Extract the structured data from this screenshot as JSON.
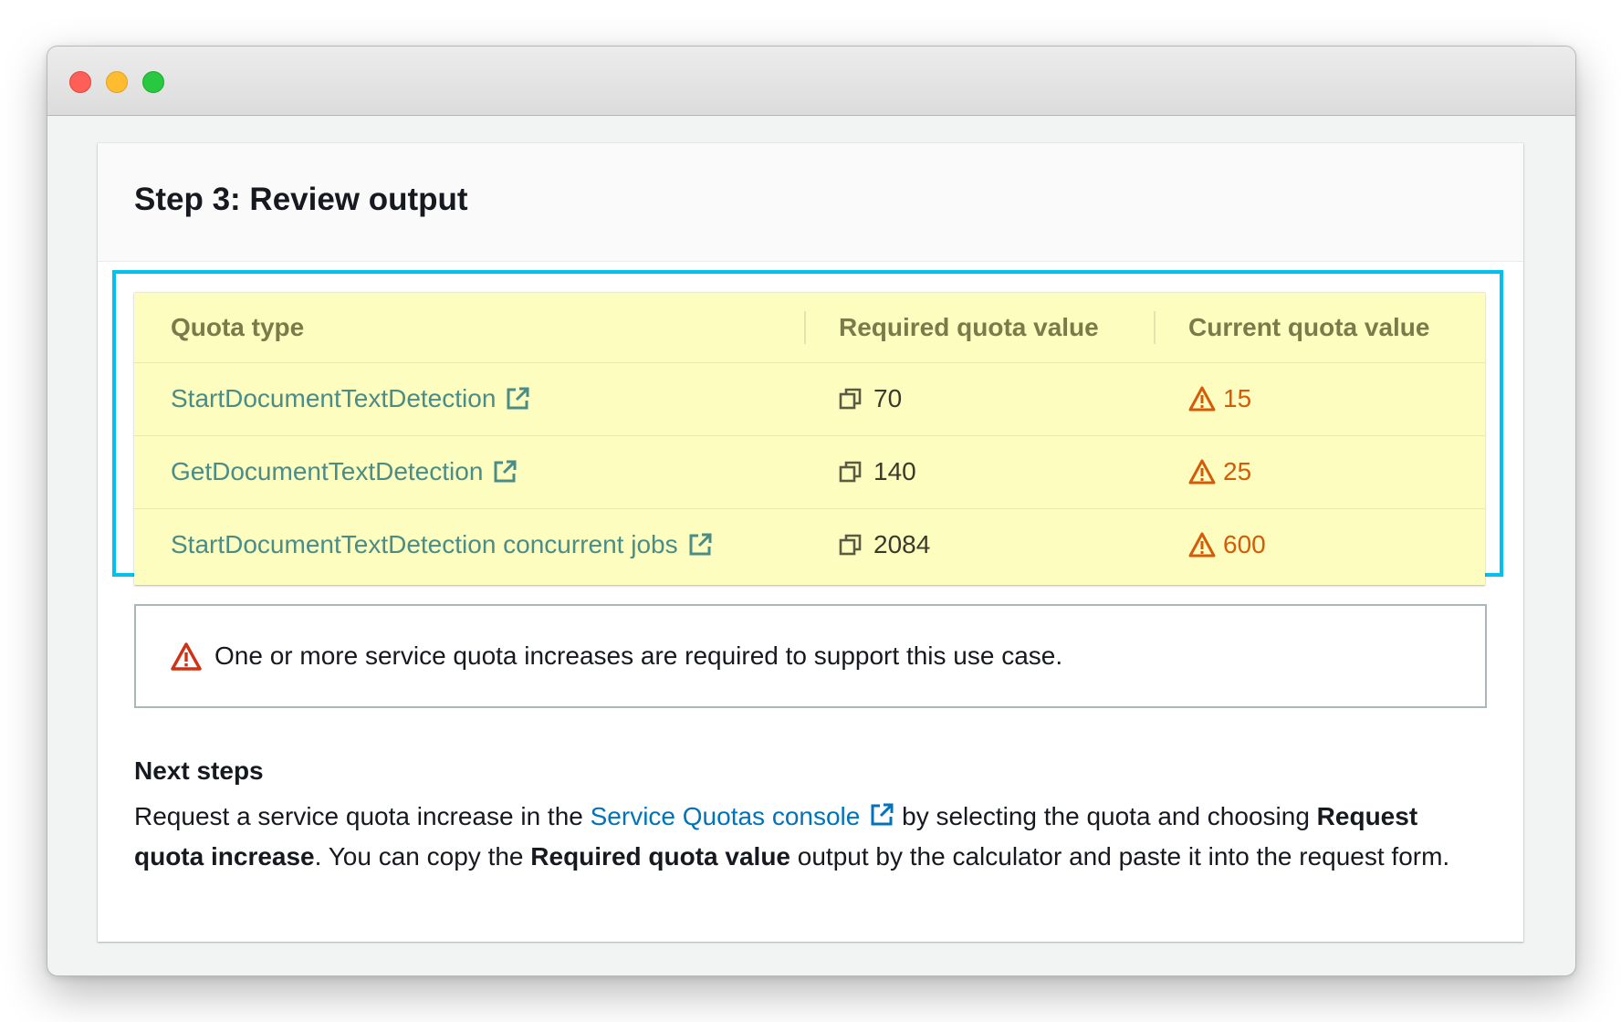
{
  "card": {
    "title": "Step 3: Review output"
  },
  "table": {
    "headers": [
      "Quota type",
      "Required quota value",
      "Current quota value"
    ],
    "rows": [
      {
        "quota_type": "StartDocumentTextDetection",
        "required": "70",
        "current": "15"
      },
      {
        "quota_type": "GetDocumentTextDetection",
        "required": "140",
        "current": "25"
      },
      {
        "quota_type": "StartDocumentTextDetection concurrent jobs",
        "required": "2084",
        "current": "600"
      }
    ],
    "background_color": "#fdfdc0",
    "highlight_color": "#00c0ef"
  },
  "alert": {
    "text": "One or more service quota increases are required to support this use case."
  },
  "next_steps": {
    "title": "Next steps",
    "part1": "Request a service quota increase in the ",
    "link": "Service Quotas console",
    "part2": " by selecting the quota and choosing ",
    "bold1": "Request quota increase",
    "part3": ". You can copy the ",
    "bold2": "Required quota value",
    "part4": " output by the calculator and paste it into the request form."
  },
  "icons": {
    "external_link": "external-link-icon",
    "copy": "copy-icon",
    "warning": "warning-icon"
  },
  "colors": {
    "link": "#4a8c86",
    "console_link": "#0073bb",
    "warning_orange": "#d45b07",
    "alert_red": "#d13212"
  }
}
